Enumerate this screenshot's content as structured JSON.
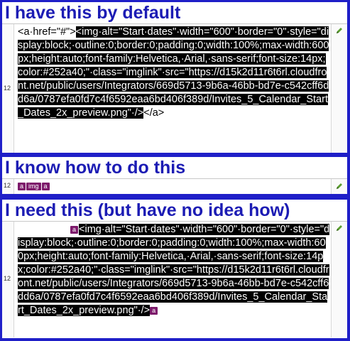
{
  "sections": [
    {
      "heading": "I have this by default",
      "line_number": "12",
      "prefix": "<a·href=\"#\">",
      "highlighted": "<img·alt=\"Start·dates\"·width=\"600\"·border=\"0\"·style=\"display:block;·outline:0;border:0;padding:0;width:100%;max-width:600px;height:auto;font-family:Helvetica,·Arial,·sans-serif;font-size:14px;color:#252a40;\"·class=\"imglink\"·src=\"https://d15k2d11r6t6rl.cloudfront.net/public/users/Integrators/669d5713-9b6a-46bb-bd7e-c542cff6dd6a/0787efa0fd7c4f6592eaa6bd406f389d/Invites_5_Calendar_Start_Dates_2x_preview.png\"·/>",
      "suffix": "</a>"
    },
    {
      "heading": "I know how to do this",
      "line_number": "12",
      "tags": [
        "a",
        "img",
        "a"
      ]
    },
    {
      "heading": "I need this (but have no idea how)",
      "line_number": "12",
      "tag_before": "a",
      "highlighted": "<img·alt=\"Start·dates\"·width=\"600\"·border=\"0\"·style=\"display:block;·outline:0;border:0;padding:0;width:100%;max-width:600px;height:auto;font-family:Helvetica,·Arial,·sans-serif;font-size:14px;color:#252a40;\"·class=\"imglink\"·src=\"https://d15k2d11r6t6rl.cloudfront.net/public/users/Integrators/669d5713-9b6a-46bb-bd7e-c542cff6dd6a/0787efa0fd7c4f6592eaa6bd406f389d/Invites_5_Calendar_Start_Dates_2x_preview.png\"·/>",
      "tag_after": "a"
    }
  ],
  "colors": {
    "frame": "#1f1fc8",
    "heading": "#1c1cb4",
    "tag": "#7d1a6b",
    "highlight": "#000000"
  },
  "icons": {
    "edit": "pencil-icon"
  }
}
